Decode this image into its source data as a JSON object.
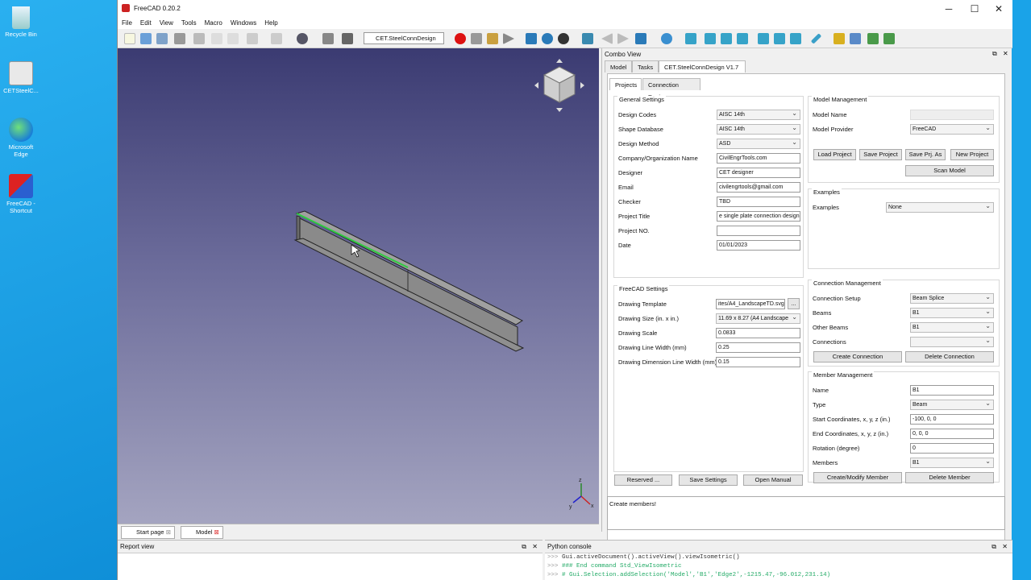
{
  "desktop": {
    "icons": [
      {
        "label": "Recycle Bin"
      },
      {
        "label": "CETSteelC..."
      },
      {
        "label": "Microsoft Edge"
      },
      {
        "label": "FreeCAD - Shortcut"
      }
    ]
  },
  "window": {
    "title": "FreeCAD 0.20.2",
    "minimize": "─",
    "maximize": "☐",
    "close": "✕"
  },
  "menu": [
    "File",
    "Edit",
    "View",
    "Tools",
    "Macro",
    "Windows",
    "Help"
  ],
  "toolbar": {
    "workbench": "CET.SteelConnDesign"
  },
  "doc_tabs": [
    "Start page",
    "Model"
  ],
  "combo": {
    "title": "Combo View",
    "tabs": [
      "Model",
      "Tasks",
      "CET.SteelConnDesign V1.7"
    ],
    "subtabs": [
      "Projects",
      "Connection Design"
    ]
  },
  "general": {
    "title": "General Settings",
    "rows": [
      {
        "label": "Design Codes",
        "value": "AISC 14th",
        "kind": "select"
      },
      {
        "label": "Shape Database",
        "value": "AISC 14th",
        "kind": "select"
      },
      {
        "label": "Design Method",
        "value": "ASD",
        "kind": "select"
      },
      {
        "label": "Company/Organization Name",
        "value": "CivilEngrTools.com",
        "kind": "input"
      },
      {
        "label": "Designer",
        "value": "CET designer",
        "kind": "input"
      },
      {
        "label": "Email",
        "value": "civilengrtools@gmail.com",
        "kind": "input"
      },
      {
        "label": "Checker",
        "value": "TBD",
        "kind": "input"
      },
      {
        "label": "Project Title",
        "value": "e single plate connection design",
        "kind": "input"
      },
      {
        "label": "Project NO.",
        "value": "",
        "kind": "input"
      },
      {
        "label": "Date",
        "value": "01/01/2023",
        "kind": "input"
      }
    ]
  },
  "freecad": {
    "title": "FreeCAD Settings",
    "rows": [
      {
        "label": "Drawing Template",
        "value": "ites/A4_LandscapeTD.svg",
        "kind": "input"
      },
      {
        "label": "Drawing Size (in. x in.)",
        "value": "11.69 x 8.27 (A4 Landscape",
        "kind": "select"
      },
      {
        "label": "Drawing Scale",
        "value": "0.0833",
        "kind": "input"
      },
      {
        "label": "Drawing Line Width (mm)",
        "value": "0.25",
        "kind": "input"
      },
      {
        "label": "Drawing Dimension Line Width (mm)",
        "value": "0.15",
        "kind": "input"
      }
    ],
    "browse": "..."
  },
  "left_buttons": [
    "Reserved ...",
    "Save Settings",
    "Open Manual"
  ],
  "model_mgmt": {
    "title": "Model Management",
    "name_label": "Model Name",
    "name_value": "",
    "provider_label": "Model Provider",
    "provider_value": "FreeCAD",
    "buttons": [
      "Load Project",
      "Save Project",
      "Save Prj. As",
      "New Project"
    ],
    "scan": "Scan Model"
  },
  "examples": {
    "title": "Examples",
    "label": "Examples",
    "value": "None"
  },
  "conn_mgmt": {
    "title": "Connection Management",
    "rows": [
      {
        "label": "Connection Setup",
        "value": "Beam Splice"
      },
      {
        "label": "Beams",
        "value": "B1"
      },
      {
        "label": "Other Beams",
        "value": "B1"
      },
      {
        "label": "Connections",
        "value": ""
      }
    ],
    "buttons": [
      "Create Connection",
      "Delete Connection"
    ]
  },
  "member_mgmt": {
    "title": "Member Management",
    "rows": [
      {
        "label": "Name",
        "value": "B1",
        "kind": "input"
      },
      {
        "label": "Type",
        "value": "Beam",
        "kind": "select"
      },
      {
        "label": "Start Coordinates, x, y, z (in.)",
        "value": "-100, 0, 0",
        "kind": "input"
      },
      {
        "label": "End Coordinates, x, y, z (in.)",
        "value": "0, 0, 0",
        "kind": "input"
      },
      {
        "label": "Rotation (degree)",
        "value": "0",
        "kind": "input"
      },
      {
        "label": "Members",
        "value": "B1",
        "kind": "select"
      }
    ],
    "buttons": [
      "Create/Modify Member",
      "Delete Member"
    ]
  },
  "message": "Create members!",
  "report": {
    "title": "Report view"
  },
  "python": {
    "title": "Python console",
    "prompt": ">>>",
    "lines": [
      "Gui.activeDocument().activeView().viewIsometric()",
      "### End command Std_ViewIsometric",
      "# Gui.Selection.addSelection('Model','B1','Edge2',-1215.47,-96.012,231.14)"
    ]
  },
  "colors": {
    "desktop": "#1aa3e8",
    "view_top": "#3b3b72",
    "view_bottom": "#a4a4c0",
    "beam": "#8a8a8a",
    "edge_highlight": "#2ecc40"
  }
}
